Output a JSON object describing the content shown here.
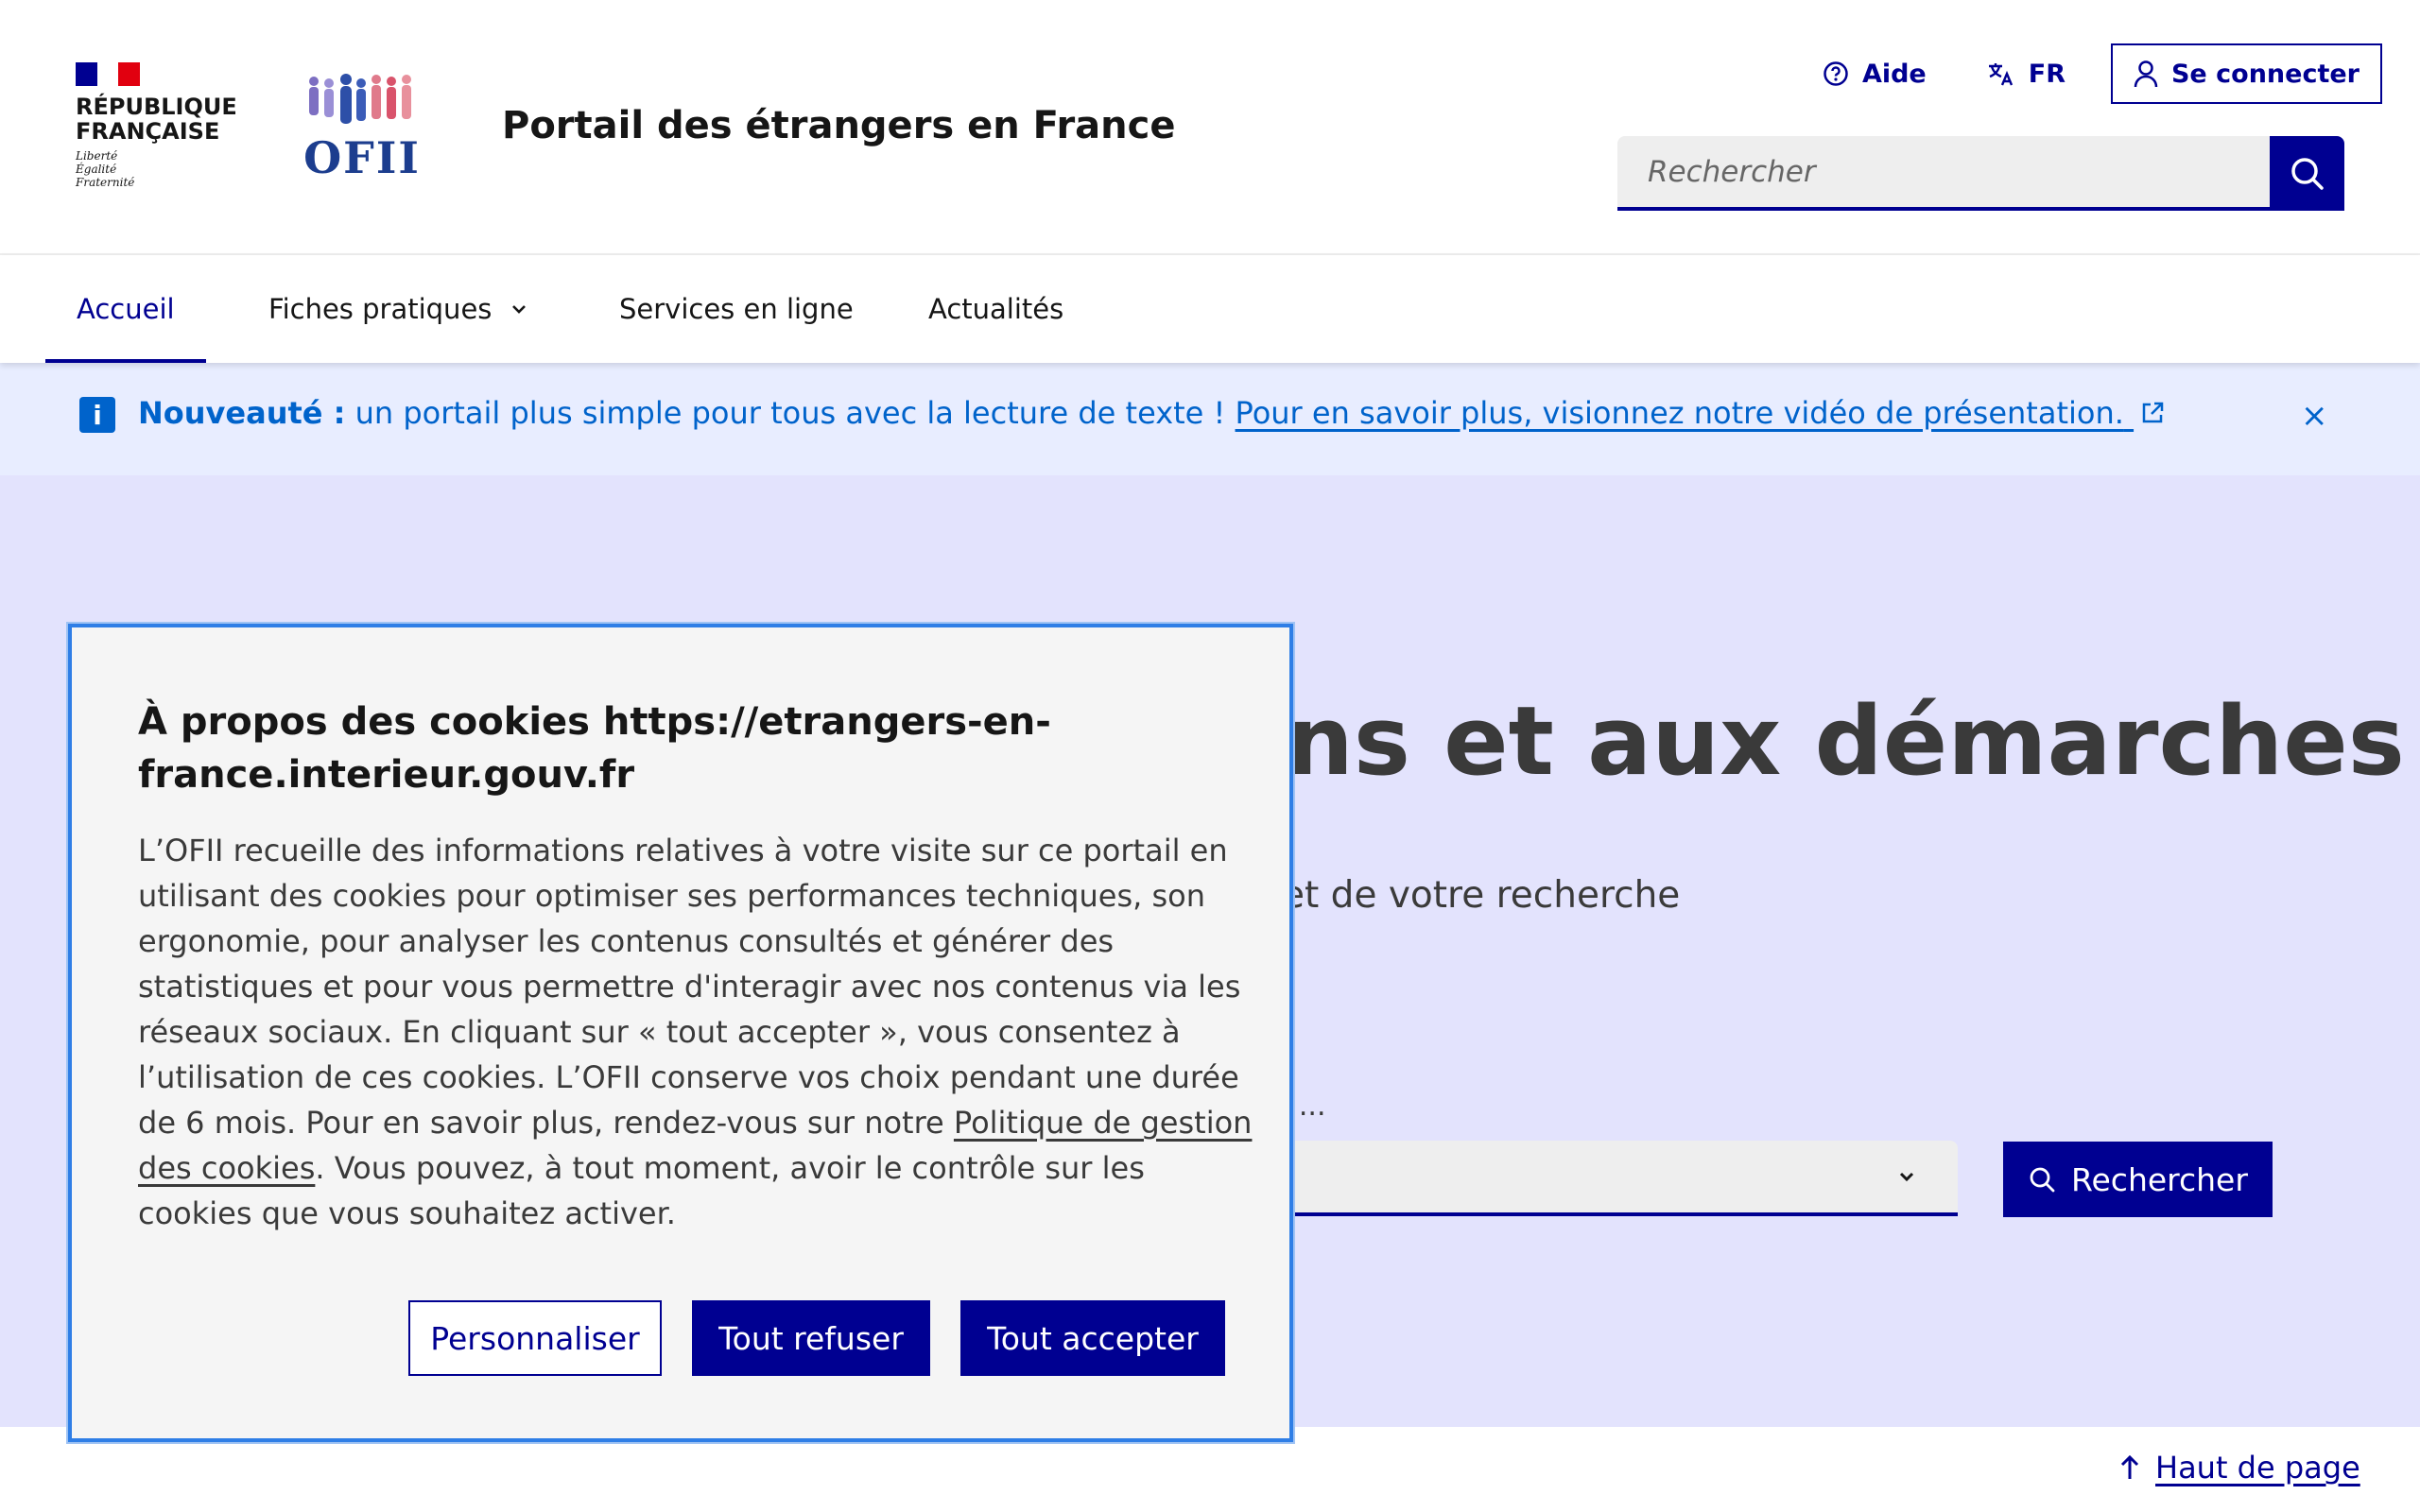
{
  "header": {
    "rf_lines": [
      "RÉPUBLIQUE",
      "FRANÇAISE"
    ],
    "devise": [
      "Liberté",
      "Égalité",
      "Fraternité"
    ],
    "ofii_text": "OFII",
    "site_title": "Portail des étrangers en France",
    "quick_links": {
      "help": "Aide",
      "lang": "FR",
      "login": "Se connecter"
    },
    "search_placeholder": "Rechercher"
  },
  "nav": {
    "items": [
      {
        "label": "Accueil",
        "active": true
      },
      {
        "label": "Fiches pratiques",
        "has_dropdown": true
      },
      {
        "label": "Services en ligne"
      },
      {
        "label": "Actualités"
      }
    ]
  },
  "notice": {
    "icon": "i",
    "strong": "Nouveauté :",
    "text": " un portail plus simple pour tous avec la lecture de texte ! ",
    "link": "Pour en savoir plus, visionnez notre vidéo de présentation.",
    "close": "×"
  },
  "hero": {
    "title_visible": "ns et aux démarches",
    "subtitle_visible": "et de votre recherche",
    "label_visible": "r ...",
    "search_button": "Rechercher"
  },
  "back_to_top": "Haut de page",
  "cookie": {
    "title": "À propos des cookies https://etrangers-en-france.interieur.gouv.fr",
    "body_before_link": "L’OFII recueille des informations relatives à votre visite sur ce portail en utilisant des cookies pour optimiser ses performances techniques, son ergonomie, pour analyser les contenus consultés et générer des statistiques et pour vous permettre d'interagir avec nos contenus via les réseaux sociaux. En cliquant sur « tout accepter », vous consentez à l’utilisation de ces cookies. L’OFII conserve vos choix pendant une durée de 6 mois. Pour en savoir plus, rendez-vous sur notre ",
    "body_link": "Politique de gestion des cookies",
    "body_after_link": ". Vous pouvez, à tout moment, avoir le contrôle sur les cookies que vous souhaitez activer.",
    "buttons": {
      "customize": "Personnaliser",
      "refuse": "Tout refuser",
      "accept": "Tout accepter"
    }
  },
  "colors": {
    "primary": "#000091",
    "info": "#0063cb",
    "hero_bg": "#e3e3fd",
    "notice_bg": "#e8edff",
    "focus": "#2f7ee6"
  }
}
